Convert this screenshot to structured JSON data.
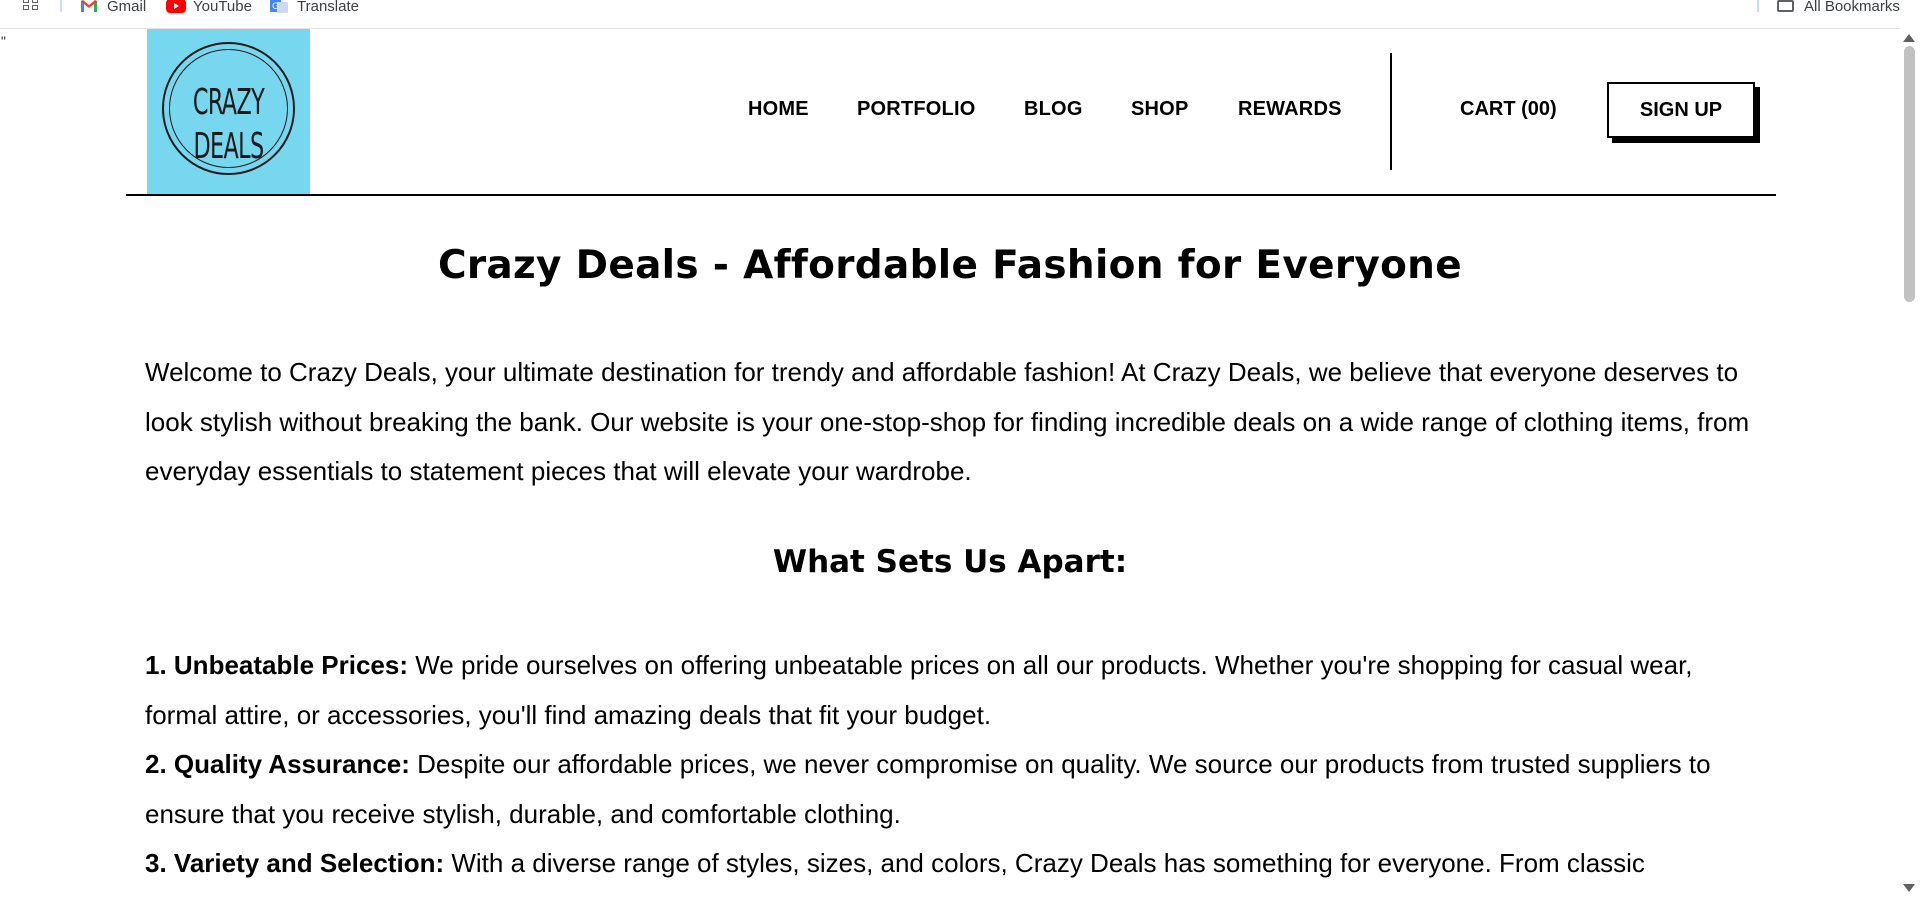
{
  "bookmarks_bar": {
    "items": [
      {
        "label": "Gmail",
        "icon": "gmail-icon"
      },
      {
        "label": "YouTube",
        "icon": "youtube-icon"
      },
      {
        "label": "Translate",
        "icon": "translate-icon"
      }
    ],
    "all_bookmarks": "All Bookmarks",
    "stray_char": "\""
  },
  "header": {
    "logo_text": "CRAZY DEALS",
    "logo_bg": "#76d7ef",
    "nav": [
      "HOME",
      "PORTFOLIO",
      "BLOG",
      "SHOP",
      "REWARDS"
    ],
    "cart": "CART (00)",
    "signup": "SIGN UP"
  },
  "main": {
    "title": "Crazy Deals - Affordable Fashion for Everyone",
    "intro": "Welcome to Crazy Deals, your ultimate destination for trendy and affordable fashion! At Crazy Deals, we believe that everyone deserves to look stylish without breaking the bank. Our website is your one-stop-shop for finding incredible deals on a wide range of clothing items, from everyday essentials to statement pieces that will elevate your wardrobe.",
    "section_heading": "What Sets Us Apart:",
    "features": [
      {
        "title": "1. Unbeatable Prices:",
        "text": " We pride ourselves on offering unbeatable prices on all our products. Whether you're shopping for casual wear, formal attire, or accessories, you'll find amazing deals that fit your budget."
      },
      {
        "title": "2. Quality Assurance:",
        "text": " Despite our affordable prices, we never compromise on quality. We source our products from trusted suppliers to ensure that you receive stylish, durable, and comfortable clothing."
      },
      {
        "title": "3. Variety and Selection:",
        "text": " With a diverse range of styles, sizes, and colors, Crazy Deals has something for everyone. From classic"
      }
    ]
  }
}
